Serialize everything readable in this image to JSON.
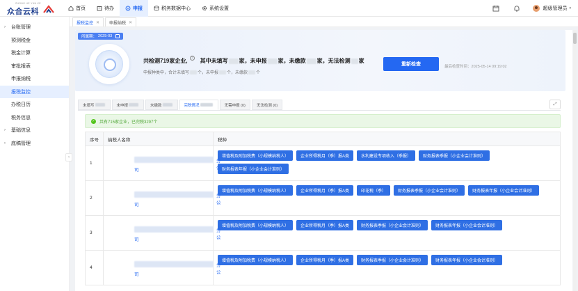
{
  "brand": {
    "small": "ZHONG HE YUN KE",
    "name": "众合云科"
  },
  "nav": [
    {
      "label": "首页",
      "icon": "home-icon"
    },
    {
      "label": "待办",
      "icon": "todo-icon"
    },
    {
      "label": "申报",
      "icon": "declare-icon"
    },
    {
      "label": "税务数据中心",
      "icon": "database-icon"
    },
    {
      "label": "系统设置",
      "icon": "gear-icon"
    }
  ],
  "user": {
    "name": "超级管理员"
  },
  "sidebar": {
    "items": [
      {
        "label": "台账管理",
        "group": true
      },
      {
        "label": "预测税金",
        "group": false
      },
      {
        "label": "税金计算",
        "group": false
      },
      {
        "label": "审批报表",
        "group": false
      },
      {
        "label": "申报纳税",
        "group": false
      },
      {
        "label": "报税监控",
        "group": false
      },
      {
        "label": "办税日历",
        "group": false
      },
      {
        "label": "税务信息",
        "group": false
      },
      {
        "label": "基础信息",
        "group": true
      },
      {
        "label": "底稿管理",
        "group": true
      }
    ],
    "active_index": 5,
    "collapse_glyph": "‹"
  },
  "page_tabs": [
    {
      "label": "报税监控"
    },
    {
      "label": "申报纳税"
    }
  ],
  "banner": {
    "period_label": "所属期：",
    "period_value": "2025-03",
    "headline_prefix": "共检测719家企业,",
    "headline_part1": "其中未填写",
    "headline_part2": "家，未申报",
    "headline_part3": "家，未缴款",
    "headline_part4": "家，无法检测",
    "headline_part5": "家",
    "sub_prefix": "申报种类中，合计未填写",
    "sub_part2": "个，未申报",
    "sub_part3": "个，未缴款",
    "sub_part4": "个",
    "recheck_label": "重新检查",
    "last_check_label": "最后检查时间：",
    "last_check_time": "2025-05-14 09:19:02"
  },
  "filter_tabs": [
    {
      "label": "未填写",
      "blurred": true
    },
    {
      "label": "未申报",
      "blurred": true
    },
    {
      "label": "未缴款",
      "blurred": true
    },
    {
      "label": "完税情况",
      "blurred": true,
      "active": true
    },
    {
      "label": "无需申报 (0)",
      "blurred": false
    },
    {
      "label": "无法检测 (0)",
      "blurred": false
    }
  ],
  "alert": {
    "text": "共有715家企业，已完税3297个"
  },
  "table": {
    "headers": [
      "序号",
      "纳税人名称",
      "税种"
    ],
    "rows": [
      {
        "no": "1",
        "name_tail": "分公",
        "name_tail2": "司",
        "taxes": [
          "增值税及附加税费（小规模纳税人）",
          "企业所得税月（季）报A类",
          "水利建设专项收入（季报）",
          "财务报表季报（小企业会计准则）",
          "财务报表年报（小企业会计准则）"
        ]
      },
      {
        "no": "2",
        "name_tail": "分公",
        "name_tail2": "司",
        "taxes": [
          "增值税及附加税费（小规模纳税人）",
          "企业所得税月（季）报A类",
          "印花税（季）",
          "财务报表季报（小企业会计准则）",
          "财务报表年报（小企业会计准则）"
        ]
      },
      {
        "no": "3",
        "name_tail": "分公",
        "name_tail2": "司",
        "taxes": [
          "增值税及附加税费（小规模纳税人）",
          "企业所得税月（季）报A类",
          "财务报表季报（小企业会计准则）",
          "财务报表年报（小企业会计准则）"
        ]
      },
      {
        "no": "4",
        "name_tail": "分公",
        "name_tail2": "司",
        "taxes": [
          "增值税及附加税费（小规模纳税人）",
          "企业所得税月（季）报A类",
          "财务报表季报（小企业会计准则）",
          "财务报表年报（小企业会计准则）"
        ]
      }
    ]
  },
  "colors": {
    "primary": "#2468f2",
    "button": "#2f6fe4",
    "success": "#52c41a"
  }
}
